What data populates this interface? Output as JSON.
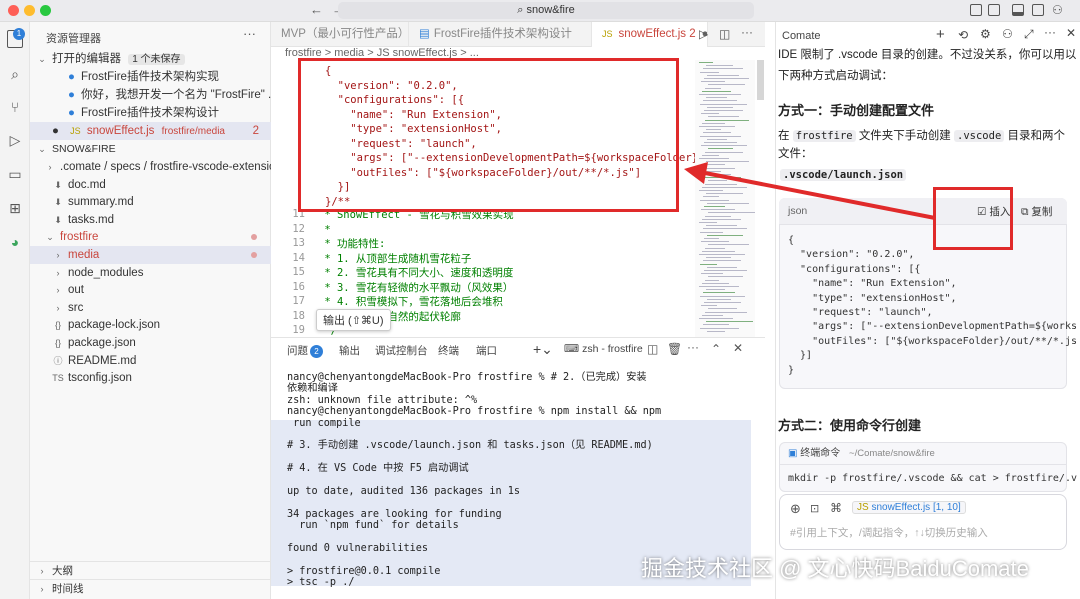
{
  "titlebar": {
    "search": "snow&fire",
    "back": "←",
    "forward": "→"
  },
  "activity": {
    "explorer_badge": "1"
  },
  "sidebar": {
    "title": "资源管理器",
    "more": "···",
    "open_editors": {
      "label": "打开的编辑器",
      "unsaved": "1 个未保存"
    },
    "open_items": [
      "FrostFire插件技术架构实现",
      "你好，我想开发一个名为 \"FrostFire\" ...",
      "FrostFire插件技术架构设计"
    ],
    "active_file": {
      "name": "snowEffect.js",
      "path": "frostfire/media",
      "count": "2"
    },
    "workspace": "SNOW&FIRE",
    "tree": [
      {
        "label": ".comate / specs / frostfire-vscode-extension",
        "icon": "›",
        "indent": 1
      },
      {
        "label": "doc.md",
        "icon": "⬇",
        "indent": 2
      },
      {
        "label": "summary.md",
        "icon": "⬇",
        "indent": 2
      },
      {
        "label": "tasks.md",
        "icon": "⬇",
        "indent": 2
      },
      {
        "label": "frostfire",
        "icon": "⌄",
        "indent": 1,
        "color": "#c9463d"
      },
      {
        "label": "media",
        "icon": "›",
        "indent": 2,
        "color": "#c9463d"
      },
      {
        "label": "node_modules",
        "icon": "›",
        "indent": 2
      },
      {
        "label": "out",
        "icon": "›",
        "indent": 2
      },
      {
        "label": "src",
        "icon": "›",
        "indent": 2
      },
      {
        "label": "package-lock.json",
        "icon": "{}",
        "indent": 2
      },
      {
        "label": "package.json",
        "icon": "{}",
        "indent": 2
      },
      {
        "label": "README.md",
        "icon": "ⓘ",
        "indent": 2
      },
      {
        "label": "tsconfig.json",
        "icon": "TS",
        "indent": 2
      }
    ],
    "outline": "大纲",
    "timeline": "时间线"
  },
  "tabs": [
    {
      "label": "MVP（最小可行性产品）..."
    },
    {
      "label": "FrostFire插件技术架构设计"
    },
    {
      "label": "snowEffect.js 2",
      "prefix": "JS"
    }
  ],
  "breadcrumb": "frostfire > media > JS snowEffect.js > ...",
  "editor": {
    "code_lines": [
      "{",
      "  \"version\": \"0.2.0\",",
      "  \"configurations\": [{",
      "    \"name\": \"Run Extension\",",
      "    \"type\": \"extensionHost\",",
      "    \"request\": \"launch\",",
      "    \"args\": [\"--extensionDevelopmentPath=${workspaceFolder}\"]",
      "    \"outFiles\": [\"${workspaceFolder}/out/**/*.js\"]",
      "  }]",
      "}/**"
    ],
    "comment_lines": [
      {
        "n": "11",
        "t": " * SnowEffect - 雪花与积雪效果实现"
      },
      {
        "n": "12",
        "t": " *"
      },
      {
        "n": "13",
        "t": " * 功能特性:"
      },
      {
        "n": "14",
        "t": " * 1. 从顶部生成随机雪花粒子"
      },
      {
        "n": "15",
        "t": " * 2. 雪花具有不同大小、速度和透明度"
      },
      {
        "n": "16",
        "t": " * 3. 雪花有轻微的水平飘动（风效果）"
      },
      {
        "n": "17",
        "t": " * 4. 积雪模拟下，雪花落地后会堆积"
      },
      {
        "n": "18",
        "t": " * 5. 积雪有自然的起伏轮廓"
      },
      {
        "n": "19",
        "t": " */"
      }
    ],
    "tooltip": "输出 (⇧⌘U)"
  },
  "panel": {
    "tabs": [
      "问题",
      "输出",
      "调试控制台",
      "终端",
      "端口"
    ],
    "problems_count": "2",
    "terminal_name": "zsh - frostfire",
    "lines": [
      "nancy@chenyantongdeMacBook-Pro frostfire % # 2.（已完成）安装",
      "依赖和编译",
      "zsh: unknown file attribute: ^%",
      "nancy@chenyantongdeMacBook-Pro frostfire % npm install && npm",
      " run compile",
      "",
      "# 3. 手动创建 .vscode/launch.json 和 tasks.json（见 README.md)",
      "",
      "# 4. 在 VS Code 中按 F5 启动调试",
      "",
      "up to date, audited 136 packages in 1s",
      "",
      "34 packages are looking for funding",
      "  run `npm fund` for details",
      "",
      "found 0 vulnerabilities",
      "",
      "> frostfire@0.0.1 compile",
      "> tsc -p ./"
    ]
  },
  "comate": {
    "title": "Comate",
    "intro_line1": "IDE 限制了 .vscode 目录的创建。不过没关系，你可以用以",
    "intro_line2": "下两种方式启动调试：",
    "method1": "方式一：手动创建配置文件",
    "m1_text1a": "在",
    "m1_code1": "frostfire",
    "m1_text1b": "文件夹下手动创建",
    "m1_code2": ".vscode",
    "m1_text1c": "目录和两个",
    "m1_text2": "文件：",
    "launch_file": ".vscode/launch.json",
    "card_lang": "json",
    "insert": "插入",
    "copy": "复制",
    "card_lines": [
      "{",
      "  \"version\": \"0.2.0\",",
      "  \"configurations\": [{",
      "    \"name\": \"Run Extension\",",
      "    \"type\": \"extensionHost\",",
      "    \"request\": \"launch\",",
      "    \"args\": [\"--extensionDevelopmentPath=${works",
      "    \"outFiles\": [\"${workspaceFolder}/out/**/*.js",
      "  }]",
      "}"
    ],
    "method2": "方式二：使用命令行创建",
    "term_title": "终端命令",
    "term_path": "~/Comate/snow&fire",
    "term_cmd": "mkdir -p frostfire/.vscode && cat > frostfire/.v",
    "context_chip": "snowEffect.js [1, 10]",
    "input_placeholder": "#引用上下文，/调起指令，↑↓切换历史输入"
  },
  "watermark": "掘金技术社区 @ 文心快码BaiduComate"
}
